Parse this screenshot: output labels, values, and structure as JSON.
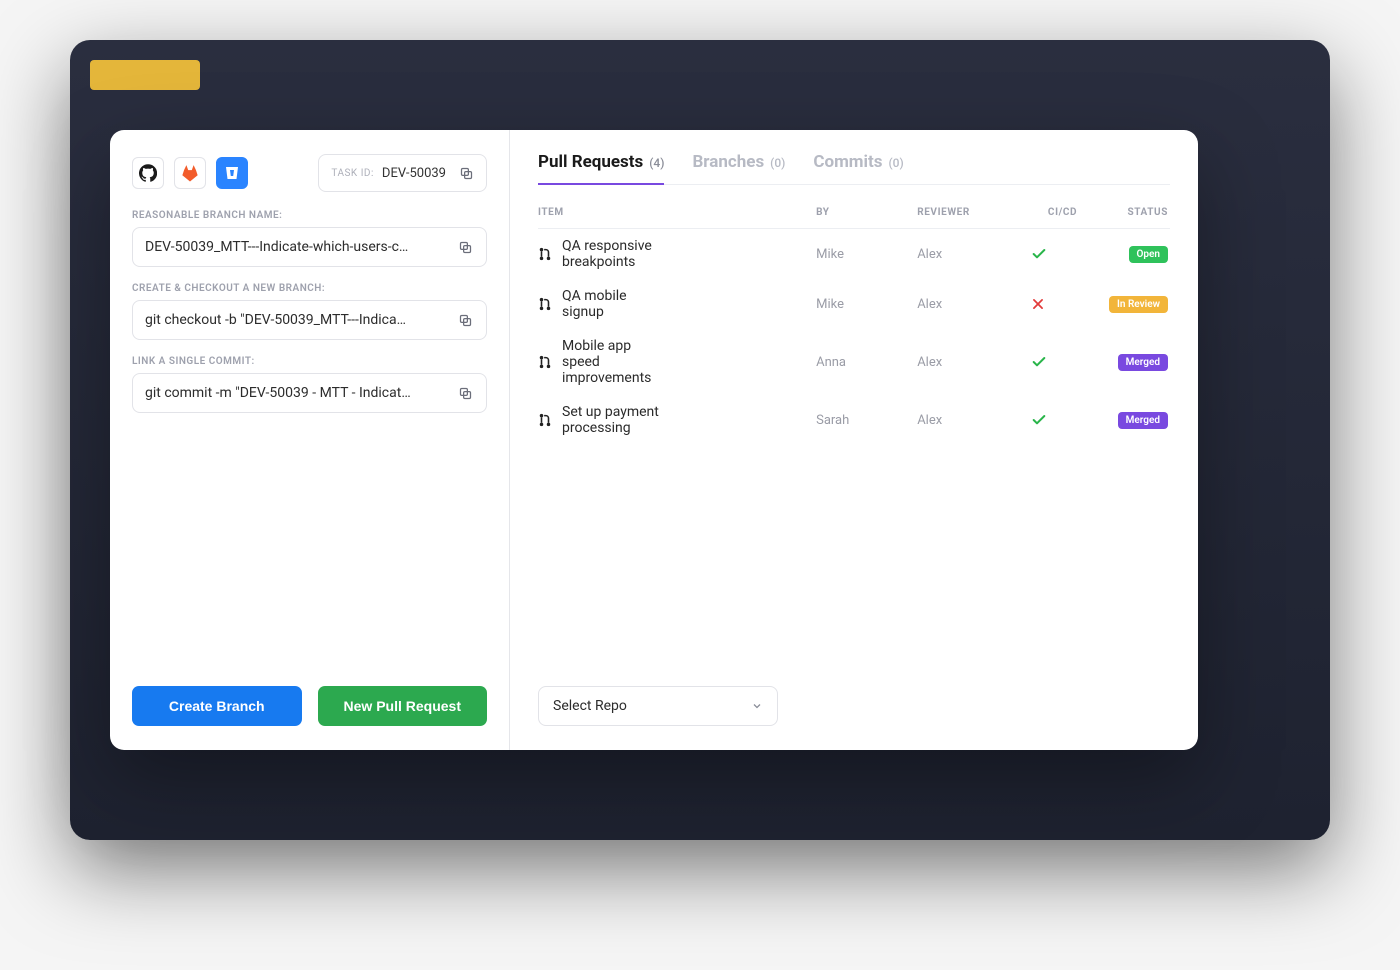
{
  "left": {
    "taskIdLabel": "TASK ID:",
    "taskId": "DEV-50039",
    "fields": {
      "branchNameLabel": "REASONABLE BRANCH NAME:",
      "branchName": "DEV-50039_MTT---Indicate-which-users-c…",
      "checkoutLabel": "CREATE & CHECKOUT A NEW BRANCH:",
      "checkout": "git checkout -b \"DEV-50039_MTT---Indica…",
      "commitLabel": "LINK A SINGLE COMMIT:",
      "commit": "git commit -m \"DEV-50039 - MTT - Indicat…"
    },
    "createBranchButton": "Create Branch",
    "newPullRequestButton": "New Pull Request"
  },
  "tabs": {
    "pullRequests": {
      "label": "Pull Requests",
      "count": "(4)"
    },
    "branches": {
      "label": "Branches",
      "count": "(0)"
    },
    "commits": {
      "label": "Commits",
      "count": "(0)"
    }
  },
  "tableHeaders": {
    "item": "ITEM",
    "by": "BY",
    "reviewer": "REVIEWER",
    "cicd": "CI/CD",
    "status": "STATUS"
  },
  "rows": [
    {
      "item": "QA responsive breakpoints",
      "by": "Mike",
      "reviewer": "Alex",
      "ci": "ok",
      "status": "Open",
      "statusClass": "badge-open"
    },
    {
      "item": "QA mobile signup",
      "by": "Mike",
      "reviewer": "Alex",
      "ci": "fail",
      "status": "In Review",
      "statusClass": "badge-review"
    },
    {
      "item": "Mobile app speed improvements",
      "by": "Anna",
      "reviewer": "Alex",
      "ci": "ok",
      "status": "Merged",
      "statusClass": "badge-merged"
    },
    {
      "item": "Set up payment processing",
      "by": "Sarah",
      "reviewer": "Alex",
      "ci": "ok",
      "status": "Merged",
      "statusClass": "badge-merged"
    }
  ],
  "selectRepo": "Select Repo"
}
